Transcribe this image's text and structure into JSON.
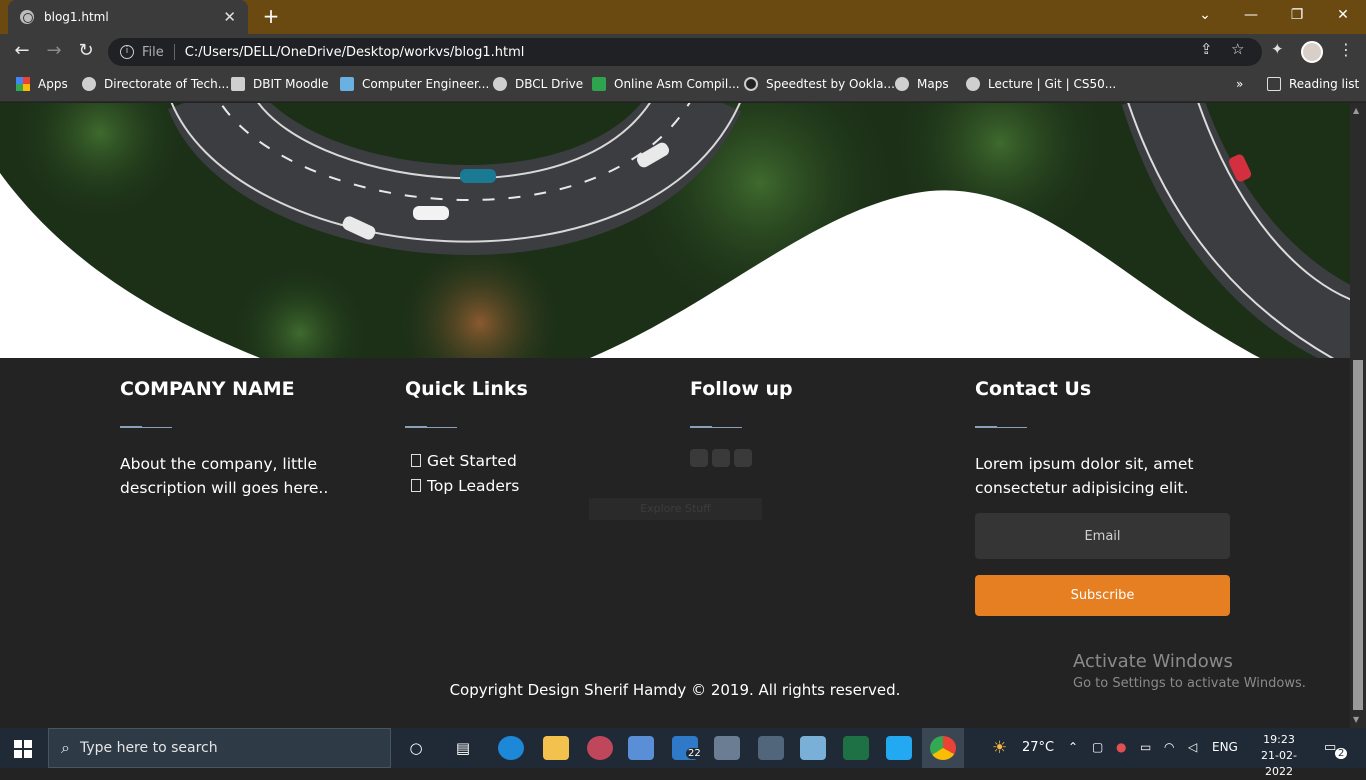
{
  "browser": {
    "tab_title": "blog1.html",
    "tab_close": "✕",
    "new_tab": "+",
    "address_scheme": "File",
    "address_url": "C:/Users/DELL/OneDrive/Desktop/workvs/blog1.html",
    "bookmarks": [
      {
        "label": "Apps"
      },
      {
        "label": "Directorate of Tech..."
      },
      {
        "label": "DBIT Moodle"
      },
      {
        "label": "Computer Engineer..."
      },
      {
        "label": "DBCL Drive"
      },
      {
        "label": "Online Asm Compil..."
      },
      {
        "label": "Speedtest by Ookla..."
      },
      {
        "label": "Maps"
      },
      {
        "label": "Lecture | Git | CS50..."
      }
    ],
    "more_bookmarks": "»",
    "reading_list": "Reading list",
    "window_controls": {
      "collapse": "⌄",
      "minimize": "—",
      "restore": "❐",
      "close": "✕"
    }
  },
  "footer": {
    "company": {
      "title": "COMPANY NAME",
      "text": "About the company, little description will goes here.."
    },
    "quick_links": {
      "title": "Quick Links",
      "items": [
        "Get Started",
        "Top Leaders"
      ]
    },
    "follow": {
      "title": "Follow up",
      "ghost_label": "Explore Stuff"
    },
    "contact": {
      "title": "Contact Us",
      "text": "Lorem ipsum dolor sit, amet consectetur adipisicing elit.",
      "email_placeholder": "Email",
      "subscribe_label": "Subscribe"
    },
    "copyright": "Copyright Design Sherif Hamdy © 2019. All rights reserved.",
    "accent_color": "#e67e22"
  },
  "watermark": {
    "line1": "Activate Windows",
    "line2": "Go to Settings to activate Windows."
  },
  "taskbar": {
    "search_placeholder": "Type here to search",
    "mail_badge": "22",
    "weather": "27°C",
    "language": "ENG",
    "time": "19:23",
    "date": "21-02-2022",
    "notifications": "2"
  }
}
